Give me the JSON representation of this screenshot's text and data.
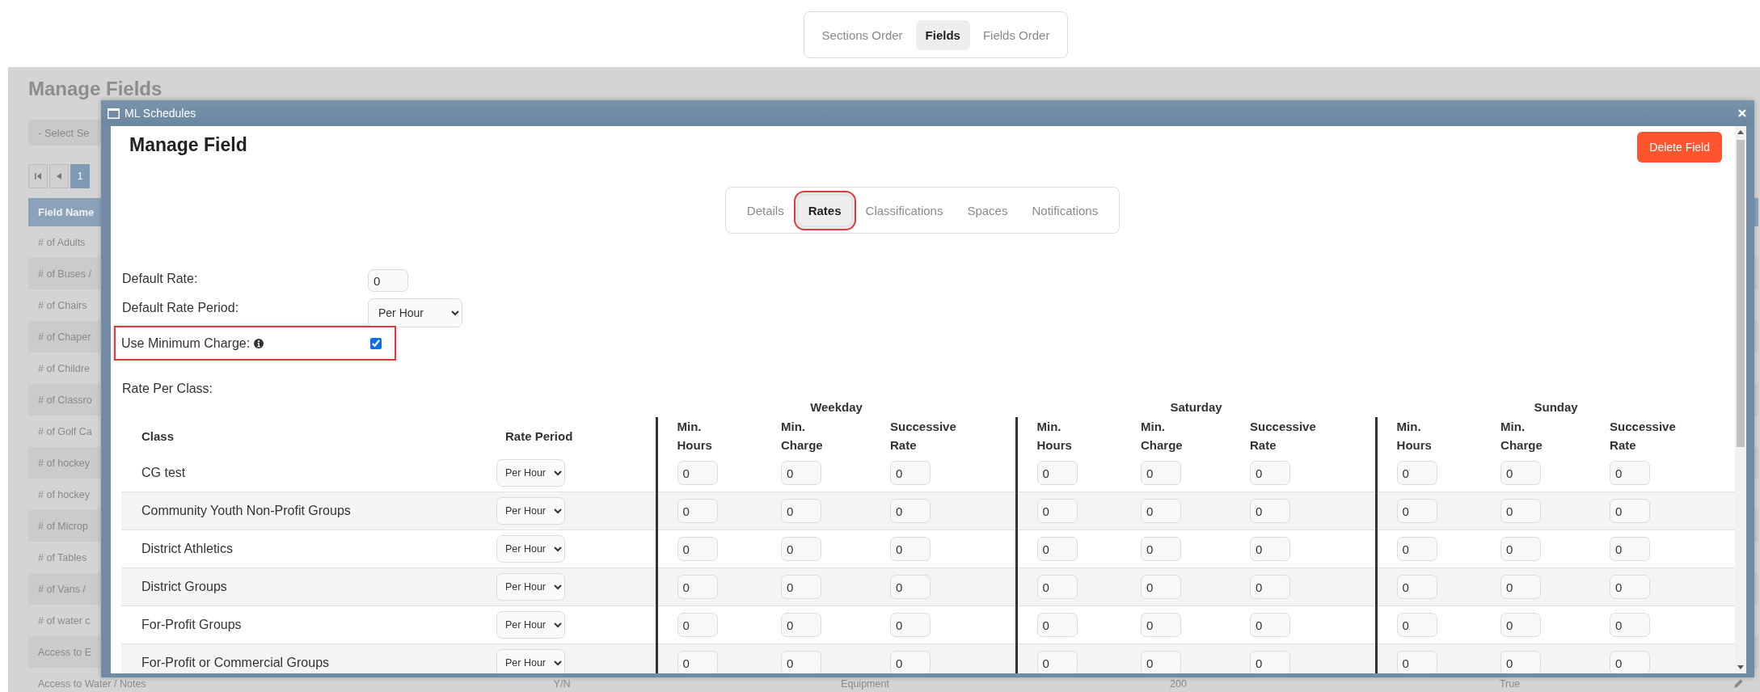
{
  "top_tabs": [
    {
      "label": "Sections Order",
      "selected": false
    },
    {
      "label": "Fields",
      "selected": true
    },
    {
      "label": "Fields Order",
      "selected": false
    }
  ],
  "background": {
    "title": "Manage Fields",
    "select_placeholder": "- Select Se",
    "pages": [
      {
        "label": "1",
        "selected": true
      }
    ],
    "table": {
      "column_1": "Field Name",
      "rows": [
        {
          "cells": [
            "# of Adults"
          ]
        },
        {
          "cells": [
            "# of Buses /"
          ]
        },
        {
          "cells": [
            "# of Chairs"
          ]
        },
        {
          "cells": [
            "# of Chaper"
          ]
        },
        {
          "cells": [
            "# of Childre"
          ]
        },
        {
          "cells": [
            "# of Classro"
          ]
        },
        {
          "cells": [
            "# of Golf Ca"
          ]
        },
        {
          "cells": [
            "# of hockey"
          ]
        },
        {
          "cells": [
            "# of hockey"
          ]
        },
        {
          "cells": [
            "# of Microp"
          ]
        },
        {
          "cells": [
            "# of Tables"
          ]
        },
        {
          "cells": [
            "# of Vans /"
          ]
        },
        {
          "cells": [
            "# of water c"
          ]
        },
        {
          "cells": [
            "Access to E"
          ]
        },
        {
          "cells": [
            "Access to Water / Notes",
            "Y/N",
            "Equipment",
            "200",
            "True"
          ]
        }
      ]
    }
  },
  "modal": {
    "title": "ML Schedules",
    "heading": "Manage Field",
    "delete_button": "Delete Field",
    "tabs": [
      {
        "label": "Details",
        "selected": false,
        "highlighted": false
      },
      {
        "label": "Rates",
        "selected": true,
        "highlighted": true
      },
      {
        "label": "Classifications",
        "selected": false,
        "highlighted": false
      },
      {
        "label": "Spaces",
        "selected": false,
        "highlighted": false
      },
      {
        "label": "Notifications",
        "selected": false,
        "highlighted": false
      }
    ],
    "fields": [
      {
        "kind": "number",
        "label": "Default Rate:",
        "value": "0",
        "highlighted": false
      },
      {
        "kind": "select",
        "label": "Default Rate Period:",
        "value": "Per Hour",
        "highlighted": false
      },
      {
        "kind": "checkbox",
        "label": "Use Minimum Charge:",
        "checked": true,
        "info": true,
        "highlighted": true
      }
    ],
    "rate_per_class_label": "Rate Per Class:",
    "rates_table": {
      "class_header": "Class",
      "rate_period_header": "Rate Period",
      "groups": [
        {
          "name": "Weekday",
          "columns": [
            "Min. Hours",
            "Min. Charge",
            "Successive Rate"
          ]
        },
        {
          "name": "Saturday",
          "columns": [
            "Min. Hours",
            "Min. Charge",
            "Successive Rate"
          ]
        },
        {
          "name": "Sunday",
          "columns": [
            "Min. Hours",
            "Min. Charge",
            "Successive Rate"
          ]
        }
      ],
      "rows": [
        {
          "class": "CG test",
          "rate_period": "Per Hour",
          "values": [
            "0",
            "0",
            "0",
            "0",
            "0",
            "0",
            "0",
            "0",
            "0"
          ]
        },
        {
          "class": "Community Youth Non-Profit Groups",
          "rate_period": "Per Hour",
          "values": [
            "0",
            "0",
            "0",
            "0",
            "0",
            "0",
            "0",
            "0",
            "0"
          ]
        },
        {
          "class": "District Athletics",
          "rate_period": "Per Hour",
          "values": [
            "0",
            "0",
            "0",
            "0",
            "0",
            "0",
            "0",
            "0",
            "0"
          ]
        },
        {
          "class": "District Groups",
          "rate_period": "Per Hour",
          "values": [
            "0",
            "0",
            "0",
            "0",
            "0",
            "0",
            "0",
            "0",
            "0"
          ]
        },
        {
          "class": "For-Profit Groups",
          "rate_period": "Per Hour",
          "values": [
            "0",
            "0",
            "0",
            "0",
            "0",
            "0",
            "0",
            "0",
            "0"
          ]
        },
        {
          "class": "For-Profit or Commercial Groups",
          "rate_period": "Per Hour",
          "values": [
            "0",
            "0",
            "0",
            "0",
            "0",
            "0",
            "0",
            "0",
            "0"
          ]
        }
      ]
    }
  }
}
